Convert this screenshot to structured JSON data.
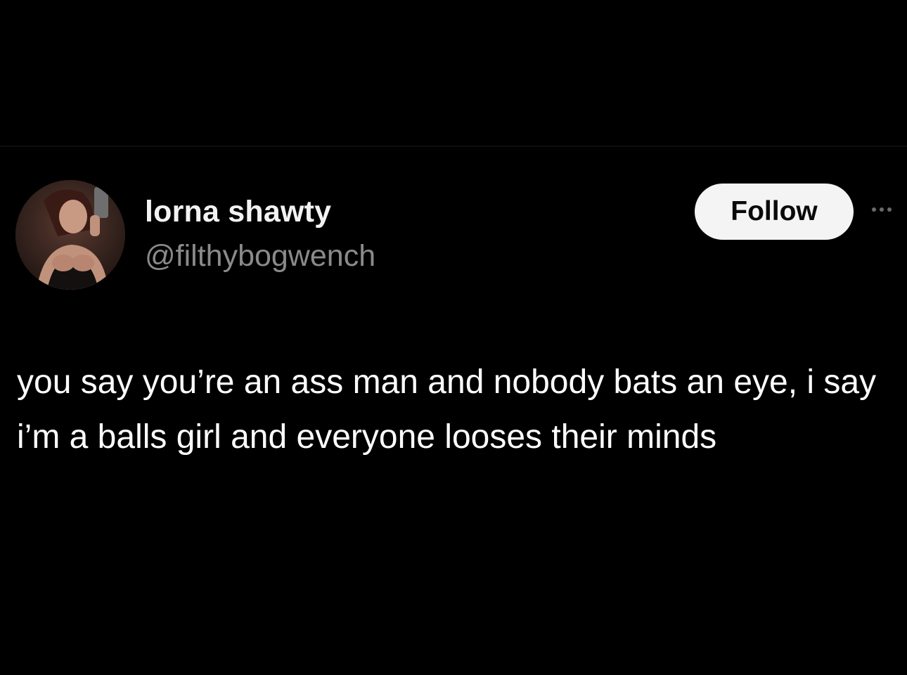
{
  "post": {
    "author": {
      "display_name": "lorna shawty",
      "handle": "@filthybogwench",
      "avatar_icon": "profile-photo"
    },
    "follow_label": "Follow",
    "more_icon": "ellipsis-icon",
    "text": "you say you’re an ass man and nobody bats an eye, i say i’m a balls girl and everyone looses their minds"
  },
  "colors": {
    "background": "#000000",
    "text": "#ffffff",
    "handle": "#8a8a8a",
    "button_bg": "#f4f4f4",
    "button_text": "#0a0a0a"
  }
}
